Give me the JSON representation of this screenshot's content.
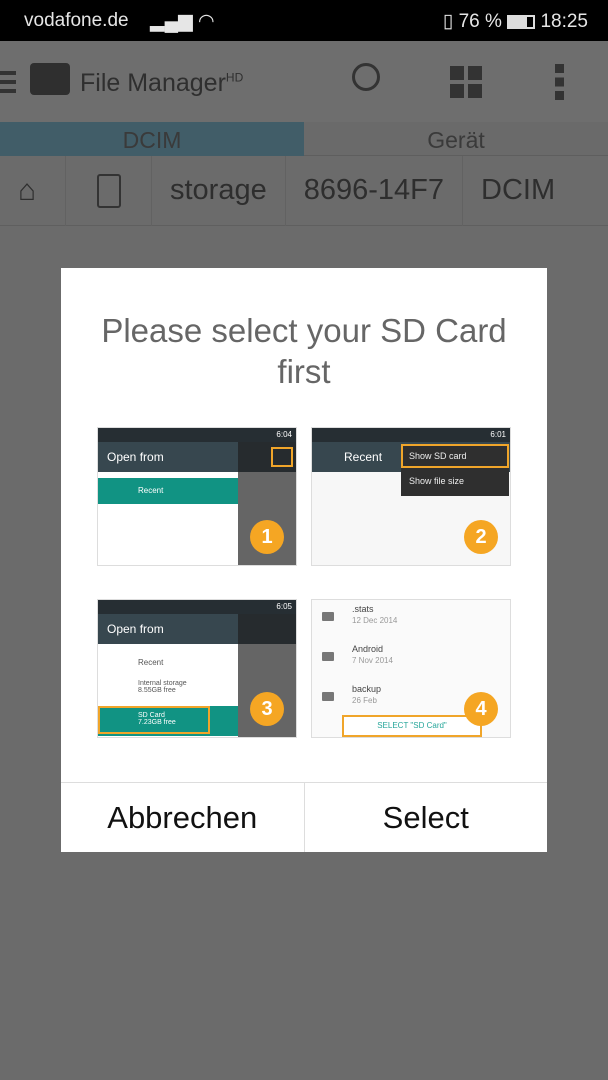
{
  "status": {
    "carrier": "vodafone.de",
    "battery": "76 %",
    "time": "18:25"
  },
  "appbar": {
    "title": "File Manager",
    "title_sup": "HD"
  },
  "tabs": [
    {
      "label": "DCIM",
      "active": true
    },
    {
      "label": "Gerät",
      "active": false
    }
  ],
  "breadcrumb": [
    "storage",
    "8696-14F7",
    "DCIM"
  ],
  "dialog": {
    "title": "Please select your SD Card first",
    "cancel_label": "Abbrechen",
    "select_label": "Select",
    "steps": {
      "s1": {
        "time": "6:04",
        "title": "Open from",
        "item": "Recent",
        "badge": "1"
      },
      "s2": {
        "time": "6:01",
        "title": "Recent",
        "menu": [
          "Show SD card",
          "Show file size"
        ],
        "badge": "2"
      },
      "s3": {
        "time": "6:05",
        "title": "Open from",
        "recent": "Recent",
        "internal": "Internal storage",
        "internal_free": "8.55GB free",
        "sd": "SD Card",
        "sd_free": "7.23GB free",
        "badge": "3"
      },
      "s4": {
        "folders": [
          {
            "name": ".stats",
            "date": "12 Dec 2014"
          },
          {
            "name": "Android",
            "date": "7 Nov 2014"
          },
          {
            "name": "backup",
            "date": "26 Feb"
          }
        ],
        "button": "SELECT \"SD Card\"",
        "badge": "4"
      }
    }
  },
  "colors": {
    "accent": "#f5a623",
    "teal": "#119383",
    "scrim": "#6b6b6b"
  }
}
